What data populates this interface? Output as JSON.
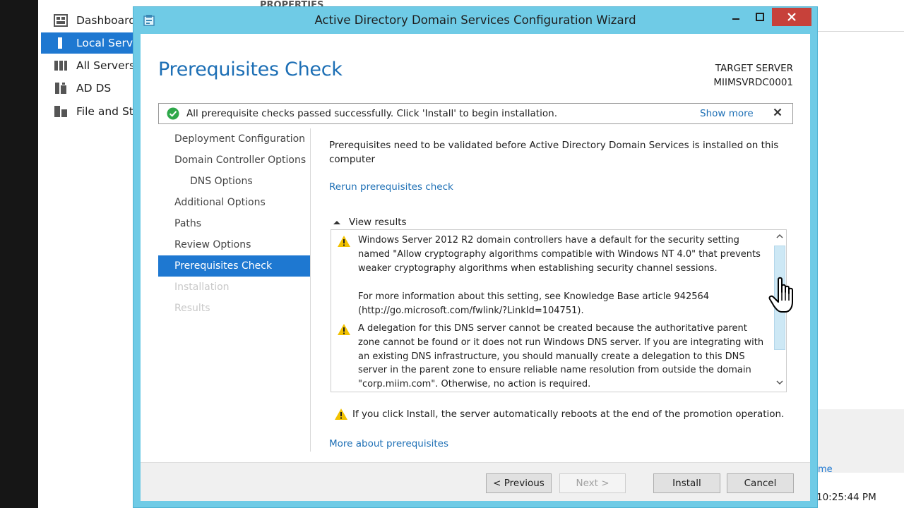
{
  "server_manager": {
    "nav_items": [
      {
        "label": "Dashboard",
        "icon": "dashboard-icon"
      },
      {
        "label": "Local Server",
        "icon": "local-server-icon"
      },
      {
        "label": "All Servers",
        "icon": "all-servers-icon"
      },
      {
        "label": "AD DS",
        "icon": "ad-ds-icon"
      },
      {
        "label": "File and Storage Services",
        "icon": "file-storage-icon"
      }
    ],
    "top_label": "PROPERTIES",
    "right_link": "me",
    "clock": "10:25:44 PM"
  },
  "wizard": {
    "title": "Active Directory Domain Services Configuration Wizard",
    "window_controls": {
      "minimize": "‒",
      "maximize": "□",
      "close": "✕"
    },
    "heading": "Prerequisites Check",
    "target_server_label": "TARGET SERVER",
    "target_server_name": "MIIMSVRDC0001",
    "banner": {
      "message": "All prerequisite checks passed successfully.  Click 'Install' to begin installation.",
      "show_more": "Show more",
      "close": "✕"
    },
    "steps": [
      {
        "label": "Deployment Configuration",
        "state": "normal",
        "sub": false
      },
      {
        "label": "Domain Controller Options",
        "state": "normal",
        "sub": false
      },
      {
        "label": "DNS Options",
        "state": "normal",
        "sub": true
      },
      {
        "label": "Additional Options",
        "state": "normal",
        "sub": false
      },
      {
        "label": "Paths",
        "state": "normal",
        "sub": false
      },
      {
        "label": "Review Options",
        "state": "normal",
        "sub": false
      },
      {
        "label": "Prerequisites Check",
        "state": "current",
        "sub": false
      },
      {
        "label": "Installation",
        "state": "disabled",
        "sub": false
      },
      {
        "label": "Results",
        "state": "disabled",
        "sub": false
      }
    ],
    "intro": "Prerequisites need to be validated before Active Directory Domain Services is installed on this computer",
    "rerun_link": "Rerun prerequisites check",
    "view_results": "View results",
    "results": [
      {
        "paragraphs": [
          "Windows Server 2012 R2 domain controllers have a default for the security setting named \"Allow cryptography algorithms compatible with Windows NT 4.0\" that prevents weaker cryptography algorithms when establishing security channel sessions.",
          "For more information about this setting, see Knowledge Base article 942564 (http://go.microsoft.com/fwlink/?LinkId=104751)."
        ]
      },
      {
        "paragraphs": [
          "A delegation for this DNS server cannot be created because the authoritative parent zone cannot be found or it does not run Windows DNS server. If you are integrating with an existing DNS infrastructure, you should manually create a delegation to this DNS server in the parent zone to ensure reliable name resolution from outside the domain \"corp.miim.com\". Otherwise, no action is required."
        ]
      }
    ],
    "reboot_note": "If you click Install, the server automatically reboots at the end of the promotion operation.",
    "more_about_link": "More about prerequisites",
    "buttons": {
      "previous": "< Previous",
      "next": "Next >",
      "install": "Install",
      "cancel": "Cancel"
    },
    "colors": {
      "frame": "#6fcbe6",
      "accent": "#1e78d1",
      "link": "#1d6fb5",
      "close_button": "#c7413a",
      "warning": "#f2c200",
      "success": "#2ea84a"
    }
  }
}
